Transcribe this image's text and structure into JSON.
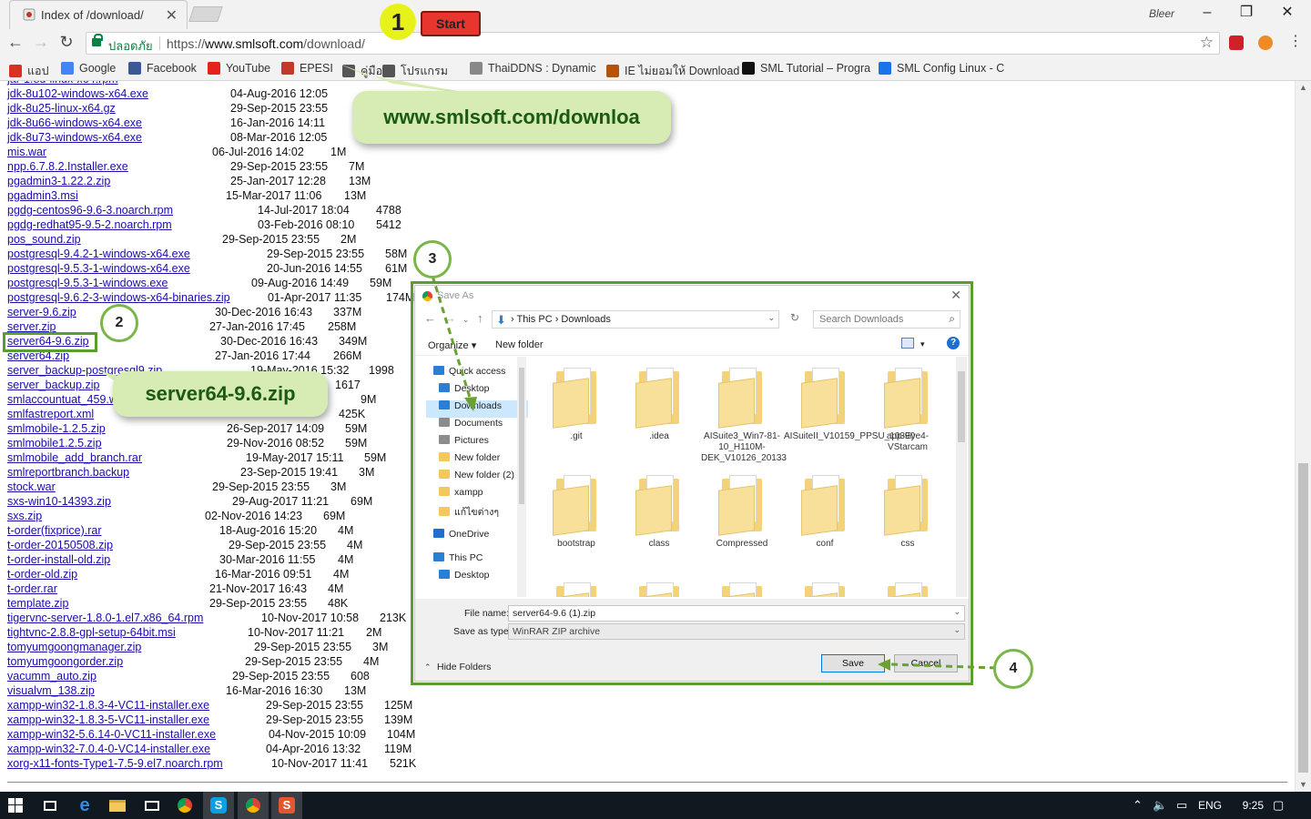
{
  "browser": {
    "tab_title": "Index of /download/",
    "user_name": "Bleer",
    "window_minimize": "–",
    "window_maximize": "❐",
    "window_close": "✕",
    "secure_label": "ปลอดภัย",
    "url_scheme": "https://",
    "url_host": "www.smlsoft.com",
    "url_path": "/download/"
  },
  "bookmarks": [
    {
      "label": "แอป",
      "icon": "apps-grid-icon",
      "color": "#d93025"
    },
    {
      "label": "Google",
      "icon": "google-icon",
      "color": "#4285f4"
    },
    {
      "label": "Facebook",
      "icon": "facebook-icon",
      "color": "#3b5998"
    },
    {
      "label": "YouTube",
      "icon": "youtube-icon",
      "color": "#e62117"
    },
    {
      "label": "EPESI",
      "icon": "epesi-icon",
      "color": "#c0392b"
    },
    {
      "label": "คู่มือ",
      "icon": "globe-icon",
      "color": "#555555"
    },
    {
      "label": "โปรแกรม",
      "icon": "globe-icon",
      "color": "#555555"
    },
    {
      "label": "ThaiDDNS : Dynamic",
      "icon": "page-icon",
      "color": "#888888"
    },
    {
      "label": "IE ไม่ยอมให้ Download",
      "icon": "ie-icon",
      "color": "#b45309"
    },
    {
      "label": "SML Tutorial – Progra",
      "icon": "sml-icon",
      "color": "#111111"
    },
    {
      "label": "SML Config Linux - C",
      "icon": "doc-icon",
      "color": "#1a73e8"
    }
  ],
  "listing": [
    {
      "name": "jdk-8u102-windows-x64.exe",
      "date": "04-Aug-2016 12:05",
      "size": "",
      "offset": 245
    },
    {
      "name": "jdk-8u25-linux-x64.gz",
      "date": "29-Sep-2015 23:55",
      "size": "",
      "offset": 245
    },
    {
      "name": "jdk-8u66-windows-x64.exe",
      "date": "16-Jan-2016 14:11",
      "size": "",
      "offset": 245
    },
    {
      "name": "jdk-8u73-windows-x64.exe",
      "date": "08-Mar-2016 12:05",
      "size": "",
      "offset": 245
    },
    {
      "name": "mis.war",
      "date": "06-Jul-2016 14:02",
      "size": "1M",
      "offset": 225
    },
    {
      "name": "npp.6.7.8.2.Installer.exe",
      "date": "29-Sep-2015 23:55",
      "size": "7M",
      "offset": 245
    },
    {
      "name": "pgadmin3-1.22.2.zip",
      "date": "25-Jan-2017 12:28",
      "size": "13M",
      "offset": 245
    },
    {
      "name": "pgadmin3.msi",
      "date": "15-Mar-2017 11:06",
      "size": "13M",
      "offset": 240
    },
    {
      "name": "pgdg-centos96-9.6-3.noarch.rpm",
      "date": "14-Jul-2017 18:04",
      "size": "4788",
      "offset": 275
    },
    {
      "name": "pgdg-redhat95-9.5-2.noarch.rpm",
      "date": "03-Feb-2016 08:10",
      "size": "5412",
      "offset": 275
    },
    {
      "name": "pos_sound.zip",
      "date": "29-Sep-2015 23:55",
      "size": "2M",
      "offset": 236
    },
    {
      "name": "postgresql-9.4.2-1-windows-x64.exe",
      "date": "29-Sep-2015 23:55",
      "size": "58M",
      "offset": 285
    },
    {
      "name": "postgresql-9.5.3-1-windows-x64.exe",
      "date": "20-Jun-2016 14:55",
      "size": "61M",
      "offset": 285
    },
    {
      "name": "postgresql-9.5.3-1-windows.exe",
      "date": "09-Aug-2016 14:49",
      "size": "59M",
      "offset": 268
    },
    {
      "name": "postgresql-9.6.2-3-windows-x64-binaries.zip",
      "date": "01-Apr-2017 11:35",
      "size": "174M",
      "offset": 286
    },
    {
      "name": "server-9.6.zip",
      "date": "30-Dec-2016 16:43",
      "size": "337M",
      "offset": 228
    },
    {
      "name": "server.zip",
      "date": "27-Jan-2016 17:45",
      "size": "258M",
      "offset": 222
    },
    {
      "name": "server64-9.6.zip",
      "date": "30-Dec-2016 16:43",
      "size": "349M",
      "offset": 234
    },
    {
      "name": "server64.zip",
      "date": "27-Jan-2016 17:44",
      "size": "266M",
      "offset": 228
    },
    {
      "name": "server_backup-postgresql9.zip",
      "date": "19-May-2016 15:32",
      "size": "1998",
      "offset": 267
    },
    {
      "name": "server_backup.zip",
      "date": "",
      "size": "1617",
      "offset": 360
    },
    {
      "name": "smlaccountuat_459.war",
      "date": "",
      "size": "9M",
      "offset": 388
    },
    {
      "name": "smlfastreport.xml",
      "date": "",
      "size": "425K",
      "offset": 364
    },
    {
      "name": "smlmobile-1.2.5.zip",
      "date": "26-Sep-2017 14:09",
      "size": "59M",
      "offset": 241
    },
    {
      "name": "smlmobile1.2.5.zip",
      "date": "29-Nov-2016 08:52",
      "size": "59M",
      "offset": 241
    },
    {
      "name": "smlmobile_add_branch.rar",
      "date": "19-May-2017 15:11",
      "size": "59M",
      "offset": 262
    },
    {
      "name": "smlreportbranch.backup",
      "date": "23-Sep-2015 19:41",
      "size": "3M",
      "offset": 256
    },
    {
      "name": "stock.war",
      "date": "29-Sep-2015 23:55",
      "size": "3M",
      "offset": 225
    },
    {
      "name": "sxs-win10-14393.zip",
      "date": "29-Aug-2017 11:21",
      "size": "69M",
      "offset": 247
    },
    {
      "name": "sxs.zip",
      "date": "02-Nov-2016 14:23",
      "size": "69M",
      "offset": 217
    },
    {
      "name": "t-order(fixprice).rar",
      "date": "18-Aug-2016 15:20",
      "size": "4M",
      "offset": 233
    },
    {
      "name": "t-order-20150508.zip",
      "date": "29-Sep-2015 23:55",
      "size": "4M",
      "offset": 243
    },
    {
      "name": "t-order-install-old.zip",
      "date": "30-Mar-2016 11:55",
      "size": "4M",
      "offset": 233
    },
    {
      "name": "t-order-old.zip",
      "date": "16-Mar-2016 09:51",
      "size": "4M",
      "offset": 228
    },
    {
      "name": "t-order.rar",
      "date": "21-Nov-2017 16:43",
      "size": "4M",
      "offset": 222
    },
    {
      "name": "template.zip",
      "date": "29-Sep-2015 23:55",
      "size": "48K",
      "offset": 222
    },
    {
      "name": "tigervnc-server-1.8.0-1.el7.x86_64.rpm",
      "date": "10-Nov-2017 10:58",
      "size": "213K",
      "offset": 279
    },
    {
      "name": "tightvnc-2.8.8-gpl-setup-64bit.msi",
      "date": "10-Nov-2017 11:21",
      "size": "2M",
      "offset": 264
    },
    {
      "name": "tomyumgoongmanager.zip",
      "date": "29-Sep-2015 23:55",
      "size": "3M",
      "offset": 271
    },
    {
      "name": "tomyumgoongorder.zip",
      "date": "29-Sep-2015 23:55",
      "size": "4M",
      "offset": 261
    },
    {
      "name": "vacumm_auto.zip",
      "date": "29-Sep-2015 23:55",
      "size": "608",
      "offset": 247
    },
    {
      "name": "visualvm_138.zip",
      "date": "16-Mar-2016 16:30",
      "size": "13M",
      "offset": 240
    },
    {
      "name": "xampp-win32-1.8.3-4-VC11-installer.exe",
      "date": "29-Sep-2015 23:55",
      "size": "125M",
      "offset": 284
    },
    {
      "name": "xampp-win32-1.8.3-5-VC11-installer.exe",
      "date": "29-Sep-2015 23:55",
      "size": "139M",
      "offset": 284
    },
    {
      "name": "xampp-win32-5.6.14-0-VC11-installer.exe",
      "date": "04-Nov-2015 10:09",
      "size": "104M",
      "offset": 287
    },
    {
      "name": "xampp-win32-7.0.4-0-VC14-installer.exe",
      "date": "04-Apr-2016 13:32",
      "size": "119M",
      "offset": 284
    },
    {
      "name": "xorg-x11-fonts-Type1-7.5-9.el7.noarch.rpm",
      "date": "10-Nov-2017 11:41",
      "size": "521K",
      "offset": 290
    }
  ],
  "dialog": {
    "title": "Save As",
    "breadcrumb": "›  This PC  ›  Downloads",
    "search_placeholder": "Search Downloads",
    "organize": "Organize ▾",
    "new_folder_btn": "New folder",
    "help": "?",
    "sidebar": [
      {
        "label": "Quick access",
        "icon": "star-icon",
        "color": "#2a7fd4",
        "pinned": false,
        "selected": false,
        "indent": 8
      },
      {
        "label": "Desktop",
        "icon": "desktop-icon",
        "color": "#2a7fd4",
        "pinned": true,
        "selected": false,
        "indent": 14
      },
      {
        "label": "Downloads",
        "icon": "download-icon",
        "color": "#2a7fd4",
        "pinned": true,
        "selected": true,
        "indent": 14
      },
      {
        "label": "Documents",
        "icon": "documents-icon",
        "color": "#8c8c8c",
        "pinned": true,
        "selected": false,
        "indent": 14
      },
      {
        "label": "Pictures",
        "icon": "pictures-icon",
        "color": "#8c8c8c",
        "pinned": true,
        "selected": false,
        "indent": 14
      },
      {
        "label": "New folder",
        "icon": "folder-icon",
        "color": "#f3c75b",
        "pinned": false,
        "selected": false,
        "indent": 14
      },
      {
        "label": "New folder (2)",
        "icon": "folder-icon",
        "color": "#f3c75b",
        "pinned": false,
        "selected": false,
        "indent": 14
      },
      {
        "label": "xampp",
        "icon": "folder-icon",
        "color": "#f3c75b",
        "pinned": false,
        "selected": false,
        "indent": 14
      },
      {
        "label": "แก้ไขต่างๆ",
        "icon": "folder-icon",
        "color": "#f3c75b",
        "pinned": false,
        "selected": false,
        "indent": 14
      },
      {
        "label": "OneDrive",
        "icon": "onedrive-icon",
        "color": "#1e6fd0",
        "pinned": false,
        "selected": false,
        "indent": 8
      },
      {
        "label": "This PC",
        "icon": "pc-icon",
        "color": "#2a7fd4",
        "pinned": false,
        "selected": false,
        "indent": 8
      },
      {
        "label": "Desktop",
        "icon": "desktop-icon",
        "color": "#2a7fd4",
        "pinned": false,
        "selected": false,
        "indent": 14
      }
    ],
    "folders": [
      {
        "name": ".git"
      },
      {
        "name": ".idea"
      },
      {
        "name": "AISuite3_Win7-81-10_H110M-DEK_V10126_20133"
      },
      {
        "name": "AISuiteII_V10159_PPSU_10390"
      },
      {
        "name": "app-Eye4-VStarcam"
      },
      {
        "name": "bootstrap"
      },
      {
        "name": "class"
      },
      {
        "name": "Compressed"
      },
      {
        "name": "conf"
      },
      {
        "name": "css"
      },
      {
        "name": ""
      },
      {
        "name": ""
      },
      {
        "name": ""
      },
      {
        "name": ""
      },
      {
        "name": ""
      }
    ],
    "filename_label": "File name:",
    "filename_value": "server64-9.6 (1).zip",
    "savetype_label": "Save as type:",
    "savetype_value": "WinRAR ZIP archive",
    "hide_folders": "Hide Folders",
    "save_btn": "Save",
    "cancel_btn": "Cancel"
  },
  "annotations": {
    "step1": "1",
    "start": "Start",
    "url_callout": "www.smlsoft.com/downloa",
    "step2": "2",
    "file_callout": "server64-9.6.zip",
    "step3": "3",
    "step4": "4"
  },
  "taskbar": {
    "lang": "ENG",
    "time": "9:25"
  }
}
